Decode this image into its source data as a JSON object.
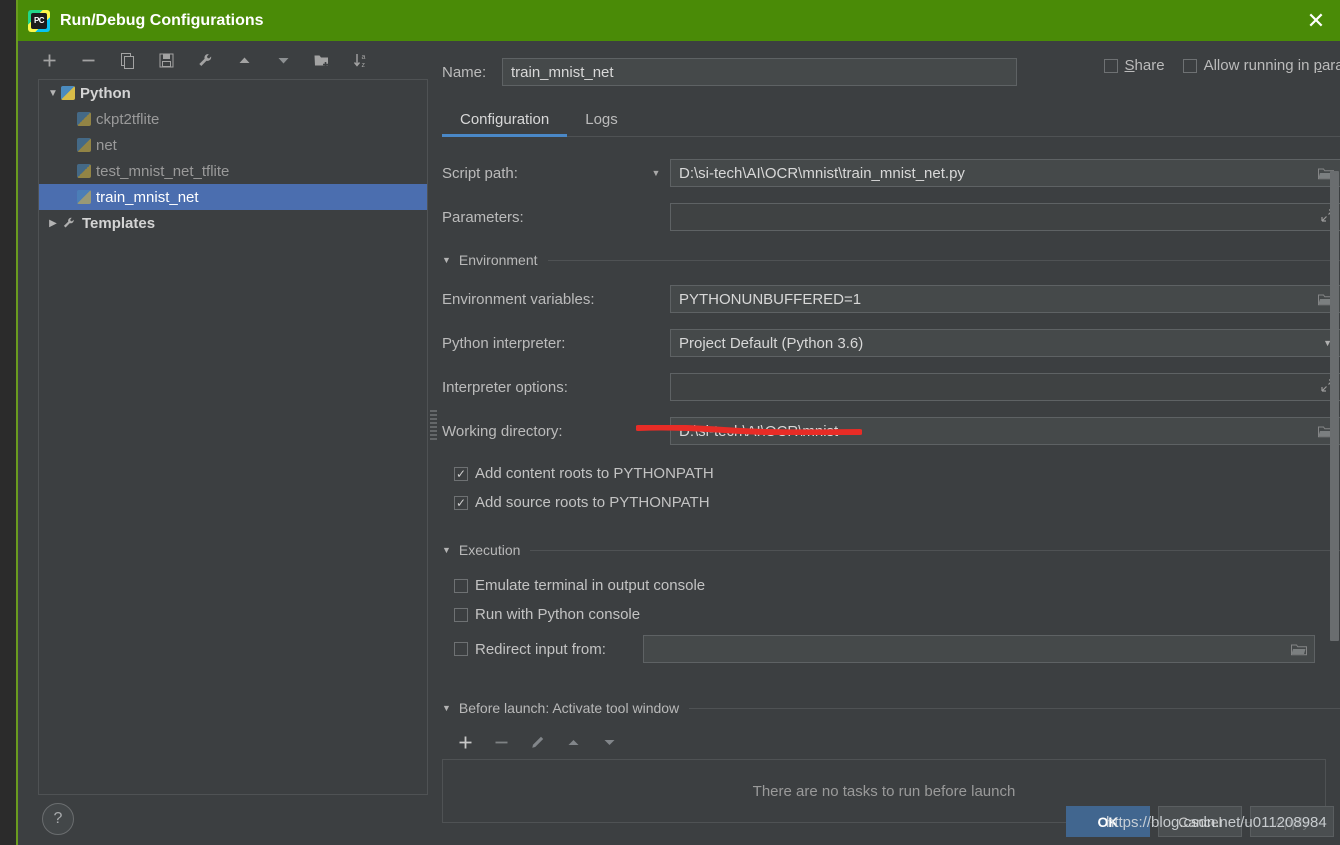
{
  "window": {
    "title": "Run/Debug Configurations",
    "app_icon": "pycharm-logo-icon",
    "logo_text": "PC",
    "close_label": "✕",
    "accent_green": "#4a8b07",
    "accent_blue": "#4a88c7",
    "selection_blue": "#4b6eaf"
  },
  "left_panel": {
    "toolbar": [
      {
        "name": "add-configuration-button",
        "glyph": "+"
      },
      {
        "name": "remove-configuration-button",
        "glyph": "−"
      },
      {
        "name": "copy-configuration-button",
        "glyph": "❐"
      },
      {
        "name": "save-configuration-button",
        "glyph": "Ὃe"
      },
      {
        "name": "edit-templates-button",
        "glyph": "wrench"
      },
      {
        "name": "move-up-button",
        "glyph": "▲"
      },
      {
        "name": "move-down-button",
        "glyph": "▼"
      },
      {
        "name": "new-folder-button",
        "glyph": "folder-plus"
      },
      {
        "name": "sort-alphabetically-button",
        "glyph": "sort-az"
      }
    ],
    "tree": [
      {
        "label": "Python",
        "level": 0,
        "expanded": true,
        "icon": "python-icon",
        "selected": false,
        "bold": true
      },
      {
        "label": "ckpt2tflite",
        "level": 1,
        "icon": "python-icon",
        "selected": false
      },
      {
        "label": "net",
        "level": 1,
        "icon": "python-icon",
        "selected": false
      },
      {
        "label": "test_mnist_net_tflite",
        "level": 1,
        "icon": "python-icon",
        "selected": false
      },
      {
        "label": "train_mnist_net",
        "level": 1,
        "icon": "python-icon",
        "selected": true
      },
      {
        "label": "Templates",
        "level": 0,
        "expanded": false,
        "icon": "wrench-icon",
        "selected": false,
        "bold": true
      }
    ]
  },
  "header": {
    "name_label": "Name:",
    "name_value": "train_mnist_net",
    "share_label": "Share",
    "share_checked": false,
    "parallel_label": "Allow running in parallel",
    "parallel_checked": false
  },
  "tabs": [
    {
      "label": "Configuration",
      "active": true
    },
    {
      "label": "Logs",
      "active": false
    }
  ],
  "form": {
    "script_path_label": "Script path:",
    "script_path_value": "D:\\si-tech\\AI\\OCR\\mnist\\train_mnist_net.py",
    "parameters_label": "Parameters:",
    "parameters_value": "",
    "environment_section": "Environment",
    "env_vars_label": "Environment variables:",
    "env_vars_value": "PYTHONUNBUFFERED=1",
    "interpreter_label": "Python interpreter:",
    "interpreter_value": "Project Default (Python 3.6)",
    "interpreter_options_label": "Interpreter options:",
    "interpreter_options_value": "",
    "working_dir_label": "Working directory:",
    "working_dir_value": "D:\\si-tech\\AI\\OCR\\mnist",
    "add_content_roots_label": "Add content roots to PYTHONPATH",
    "add_content_roots_checked": true,
    "add_source_roots_label": "Add source roots to PYTHONPATH",
    "add_source_roots_checked": true,
    "execution_section": "Execution",
    "emulate_terminal_label": "Emulate terminal in output console",
    "emulate_terminal_checked": false,
    "python_console_label": "Run with Python console",
    "python_console_checked": false,
    "redirect_input_label": "Redirect input from:",
    "redirect_input_checked": false,
    "redirect_input_value": ""
  },
  "before_launch": {
    "section_label": "Before launch: Activate tool window",
    "toolbar": [
      {
        "name": "add-task-button",
        "glyph": "+",
        "enabled": true
      },
      {
        "name": "remove-task-button",
        "glyph": "−",
        "enabled": false
      },
      {
        "name": "edit-task-button",
        "glyph": "✎",
        "enabled": false
      },
      {
        "name": "move-task-up-button",
        "glyph": "▲",
        "enabled": false
      },
      {
        "name": "move-task-down-button",
        "glyph": "▼",
        "enabled": false
      }
    ],
    "empty_text": "There are no tasks to run before launch"
  },
  "footer": {
    "help_label": "?",
    "ok_label": "OK",
    "cancel_label": "Cancel",
    "apply_label": "Apply",
    "apply_disabled": true
  },
  "annotations": {
    "watermark": "https://blog.csdn.net/u011208984",
    "red_underline_color": "#e82c26"
  }
}
